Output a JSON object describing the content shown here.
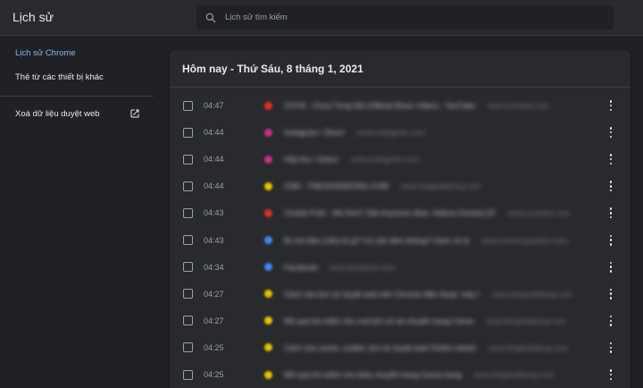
{
  "header": {
    "title": "Lịch sử",
    "search_placeholder": "Lịch sử tìm kiếm"
  },
  "sidebar": {
    "items": [
      {
        "label": "Lịch sử Chrome",
        "active": true
      },
      {
        "label": "Thẻ từ các thiết bị khác",
        "active": false
      }
    ],
    "clear_label": "Xoá dữ liệu duyệt web"
  },
  "main": {
    "date_heading": "Hôm nay - Thứ Sáu, 8 tháng 1, 2021",
    "rows": [
      {
        "time": "04:47",
        "favicon_color": "#e0301e",
        "title": "CHYN - Chưa Từng Nói (Official Music Video) - YouTube",
        "domain": "www.youtube.com"
      },
      {
        "time": "04:44",
        "favicon_color": "#c13584",
        "title": "Instagram • Direct",
        "domain": "www.instagram.com"
      },
      {
        "time": "04:44",
        "favicon_color": "#c13584",
        "title": "Hộp thư • Direct",
        "domain": "www.instagram.com"
      },
      {
        "time": "04:44",
        "favicon_color": "#e6c200",
        "title": "CNN - THEGIOIDIDONG.COM",
        "domain": "www.thegioididong.com"
      },
      {
        "time": "04:43",
        "favicon_color": "#d93025",
        "title": "Charlie Puth - We Don't Talk Anymore (feat. Selena Gomez) [OF",
        "domain": "www.youtube.com"
      },
      {
        "time": "04:43",
        "favicon_color": "#4285f4",
        "title": "Bị chó liếm (cắn) bị gì? Có cần tiêm không? Cách xử lý",
        "domain": "www.vinmecgiaydich.com"
      },
      {
        "time": "04:34",
        "favicon_color": "#4285f4",
        "title": "Facebook",
        "domain": "www.facebook.com"
      },
      {
        "time": "04:27",
        "favicon_color": "#e6c200",
        "title": "Cách xóa lịch sử duyệt web trên Chrome điện thoại, máy t",
        "domain": "www.thegioididong.com"
      },
      {
        "time": "04:27",
        "favicon_color": "#e6c200",
        "title": "Mở quá tìm kiếm cho xoá lịch sử tại chuyển trang Censs",
        "domain": "www.thegioididong.com"
      },
      {
        "time": "04:25",
        "favicon_color": "#e6c200",
        "title": "Cách xóa cache, cookie, lịch sử duyệt web Firefox nhanh",
        "domain": "www.thegioididong.com"
      },
      {
        "time": "04:25",
        "favicon_color": "#e6c200",
        "title": "Mở quá tìm kiếm cho links chuyển trang Censs trang",
        "domain": "www.thegioididong.com"
      }
    ]
  }
}
